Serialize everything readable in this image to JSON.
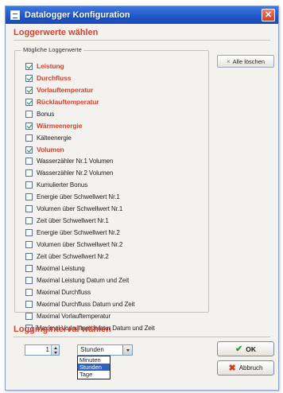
{
  "window": {
    "title": "Datalogger Konfiguration",
    "close_glyph": "✕"
  },
  "section1": {
    "title": "Loggerwerte wählen"
  },
  "group": {
    "legend": "Mögliche Loggerwerte"
  },
  "clear_button": {
    "icon": "clear-icon",
    "glyph": "×",
    "label": "Alle löschen"
  },
  "items": [
    {
      "label": "Leistung",
      "checked": true
    },
    {
      "label": "Durchfluss",
      "checked": true
    },
    {
      "label": "Vorlauftemperatur",
      "checked": true
    },
    {
      "label": "Rücklauftemperatur",
      "checked": true
    },
    {
      "label": "Bonus",
      "checked": false
    },
    {
      "label": "Wärmeenergie",
      "checked": true
    },
    {
      "label": "Kälteenergie",
      "checked": false
    },
    {
      "label": "Volumen",
      "checked": true
    },
    {
      "label": "Wasserzähler Nr.1 Volumen",
      "checked": false
    },
    {
      "label": "Wasserzähler Nr.2 Volumen",
      "checked": false
    },
    {
      "label": "Kumulierter Bonus",
      "checked": false
    },
    {
      "label": "Energie über Schwellwert Nr.1",
      "checked": false
    },
    {
      "label": "Volumen über Schwellwert Nr.1",
      "checked": false
    },
    {
      "label": "Zeit über Schwellwert Nr.1",
      "checked": false
    },
    {
      "label": "Energie über Schwellwert Nr.2",
      "checked": false
    },
    {
      "label": "Volumen über Schwellwert Nr.2",
      "checked": false
    },
    {
      "label": "Zeit über Schwellwert Nr.2",
      "checked": false
    },
    {
      "label": "Maximal Leistung",
      "checked": false
    },
    {
      "label": "Maximal Leistung Datum und Zeit",
      "checked": false
    },
    {
      "label": "Maximal Durchfluss",
      "checked": false
    },
    {
      "label": "Maximal Durchfluss Datum und Zeit",
      "checked": false
    },
    {
      "label": "Maximal Vorlauftemperatur",
      "checked": false
    },
    {
      "label": "Maximal Vorlauftemperatur Datum und Zeit",
      "checked": false
    }
  ],
  "section2": {
    "title": "Logginginterval wählen"
  },
  "interval": {
    "value": "1",
    "unit_selected": "Stunden",
    "options": [
      "Minuten",
      "Stunden",
      "Tage"
    ],
    "highlighted_index": 1
  },
  "buttons": {
    "ok_label": "OK",
    "ok_glyph": "✔",
    "cancel_label": "Abbruch",
    "cancel_glyph": "✖"
  },
  "colors": {
    "accent_red": "#d7412e",
    "title_blue": "#1f55c8",
    "selection_blue": "#2a63c5",
    "check_green": "#1f8a2a"
  }
}
